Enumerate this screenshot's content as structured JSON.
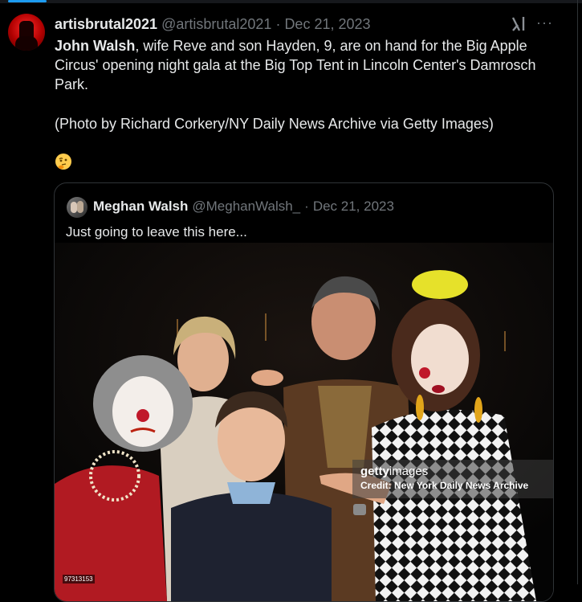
{
  "tweet": {
    "display_name": "artisbrutal2021",
    "handle": "@artisbrutal2021",
    "separator": "·",
    "date": "Dec 21, 2023",
    "body_bold": "John Walsh",
    "body_rest": ", wife Reve and son Hayden, 9, are on hand for the Big Apple Circus' opening night gala at the Big Top Tent in Lincoln Center's  Damrosch Park.",
    "credit": "(Photo by Richard Corkery/NY Daily News Archive via  Getty Images)",
    "emoji_icon": "thinking-face-icon"
  },
  "quote": {
    "display_name": "Meghan Walsh",
    "handle": "@MeghanWalsh_",
    "separator": "·",
    "date": "Dec 21, 2023",
    "text": "Just going to leave this here...",
    "image": {
      "watermark_brand": "getty",
      "watermark_brand_suffix": "images",
      "watermark_credit": "Credit: New York Daily News Archive",
      "image_id": "97313153"
    }
  },
  "icons": {
    "grok": "grok-icon",
    "more": "more-icon"
  },
  "colors": {
    "background": "#000000",
    "text": "#e7e9ea",
    "muted": "#71767b",
    "border": "#2f3336",
    "accent": "#1d9bf0"
  }
}
